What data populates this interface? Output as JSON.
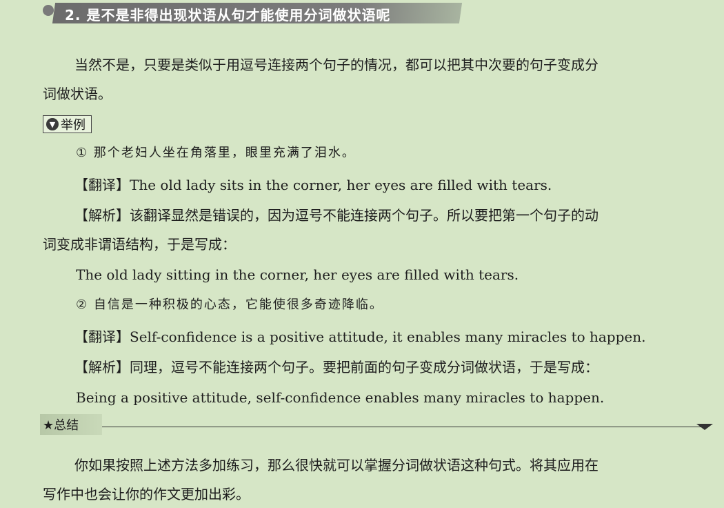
{
  "heading": "2. 是不是非得出现状语从句才能使用分词做状语呢",
  "intro": {
    "line1": "当然不是，只要是类似于用逗号连接两个句子的情况，都可以把其中次要的句子变成分",
    "line2": "词做状语。"
  },
  "example_tag": "举例",
  "example1": {
    "chinese": "① 那个老妇人坐在角落里，眼里充满了泪水。",
    "translation_label": "【翻译】",
    "translation": "The old lady sits in the corner, her eyes are filled with tears.",
    "analysis_label": "【解析】",
    "analysis_line1": "该翻译显然是错误的，因为逗号不能连接两个句子。所以要把第一个句子的动",
    "analysis_line2": "词变成非谓语结构，于是写成：",
    "correct": "The old lady sitting in the corner, her eyes are filled with tears."
  },
  "example2": {
    "chinese": "② 自信是一种积极的心态，它能使很多奇迹降临。",
    "translation_label": "【翻译】",
    "translation": "Self-confidence is a positive attitude, it enables many miracles to happen.",
    "analysis_label": "【解析】",
    "analysis": "同理，逗号不能连接两个句子。要把前面的句子变成分词做状语，于是写成：",
    "correct": "Being a positive attitude, self-confidence enables many miracles to happen."
  },
  "summary_tag": "★总结",
  "summary": {
    "line1": "你如果按照上述方法多加练习，那么很快就可以掌握分词做状语这种句式。将其应用在",
    "line2": "写作中也会让你的作文更加出彩。"
  }
}
